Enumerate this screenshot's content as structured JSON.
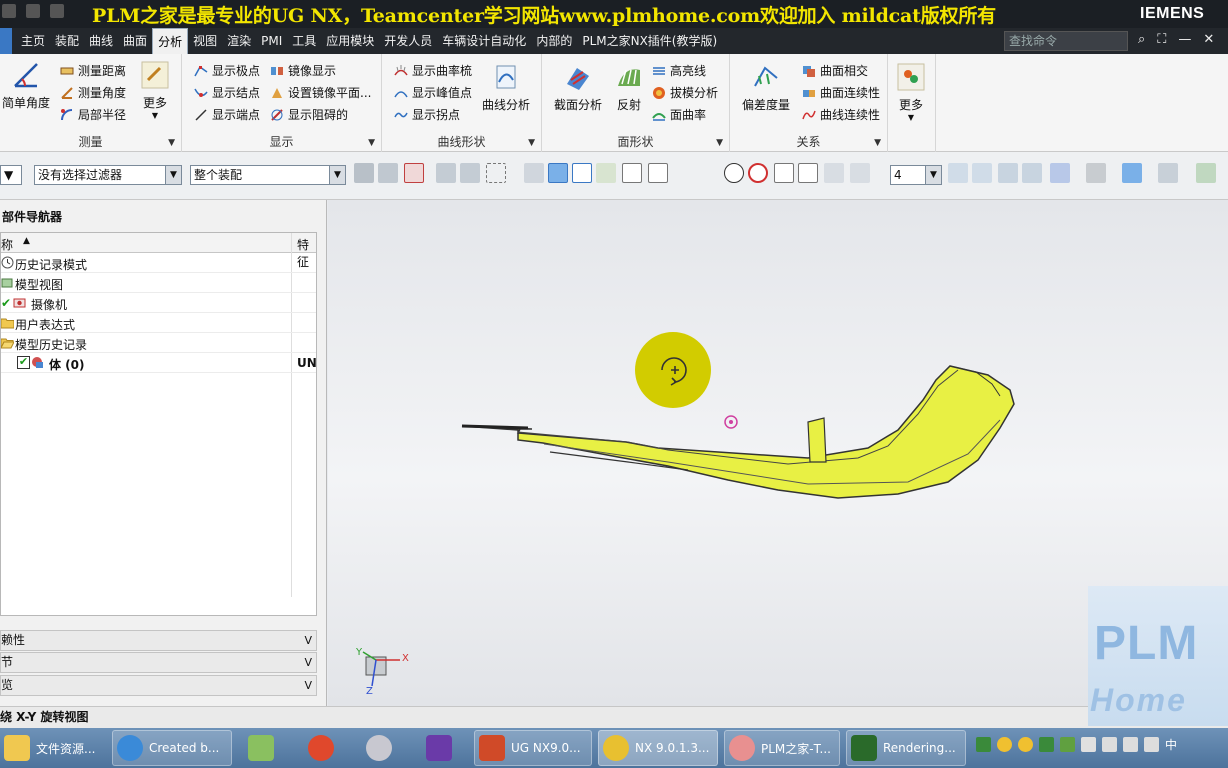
{
  "titlebar": {
    "watermark": "PLM之家是最专业的UG NX，Teamcenter学习网站www.plmhome.com欢迎加入 mildcat版权所有",
    "brand": "IEMENS"
  },
  "menu": {
    "tabs": [
      "主页",
      "装配",
      "曲线",
      "曲面",
      "分析",
      "视图",
      "渲染",
      "PMI",
      "工具",
      "应用模块",
      "开发人员",
      "车辆设计自动化",
      "内部的",
      "PLM之家NX插件(教学版)"
    ],
    "active_tab": "分析",
    "command_search_placeholder": "查找命令"
  },
  "ribbon": {
    "measure": {
      "label": "测量",
      "simple_angle": "简单角度",
      "measure_distance": "测量距离",
      "measure_angle": "测量角度",
      "local_radius": "局部半径",
      "more": "更多"
    },
    "display": {
      "label": "显示",
      "show_poles": "显示极点",
      "show_knots": "显示结点",
      "show_endpoints": "显示端点",
      "mirror_display": "镜像显示",
      "set_mirror_plane": "设置镜像平面...",
      "show_blocking": "显示阻碍的"
    },
    "curve_shape": {
      "label": "曲线形状",
      "show_curvature_comb": "显示曲率梳",
      "show_peaks": "显示峰值点",
      "show_inflections": "显示拐点",
      "curve_analysis": "曲线分析"
    },
    "face_shape": {
      "label": "面形状",
      "section_analysis": "截面分析",
      "reflection": "反射",
      "highlight_lines": "高亮线",
      "draft_analysis": "拔模分析",
      "face_curvature": "面曲率"
    },
    "relation": {
      "label": "关系",
      "deviation_gauge": "偏差度量",
      "face_intersection": "曲面相交",
      "face_continuity": "曲面连续性",
      "curve_continuity": "曲线连续性"
    },
    "more": "更多"
  },
  "toolbar": {
    "selection_filter": "没有选择过滤器",
    "assembly_scope": "整个装配",
    "number_value": "4"
  },
  "navigator": {
    "title": "部件导航器",
    "col_name": "称",
    "col_feature": "特征",
    "rows": [
      {
        "label": "历史记录模式",
        "value": ""
      },
      {
        "label": "模型视图",
        "value": ""
      },
      {
        "label": "摄像机",
        "value": ""
      },
      {
        "label": "用户表达式",
        "value": ""
      },
      {
        "label": "模型历史记录",
        "value": ""
      },
      {
        "label": "体 (0)",
        "value": "UN"
      }
    ],
    "sections": [
      "赖性",
      "节",
      "览"
    ]
  },
  "status": {
    "text": "绕 X-Y 旋转视图"
  },
  "viewport": {
    "triad_x": "X",
    "triad_y": "Y",
    "triad_z": "Z",
    "logo_plm": "PLM",
    "logo_home": "Home"
  },
  "taskbar": {
    "items": [
      "文件资源...",
      "Created b...",
      "UG NX9.0...",
      "NX 9.0.1.3...",
      "PLM之家-T...",
      "Rendering..."
    ],
    "ime": "中"
  },
  "colors": {
    "model": "#e8f044",
    "rotate_cursor": "#d2cc00",
    "watermark": "#f3e600"
  }
}
